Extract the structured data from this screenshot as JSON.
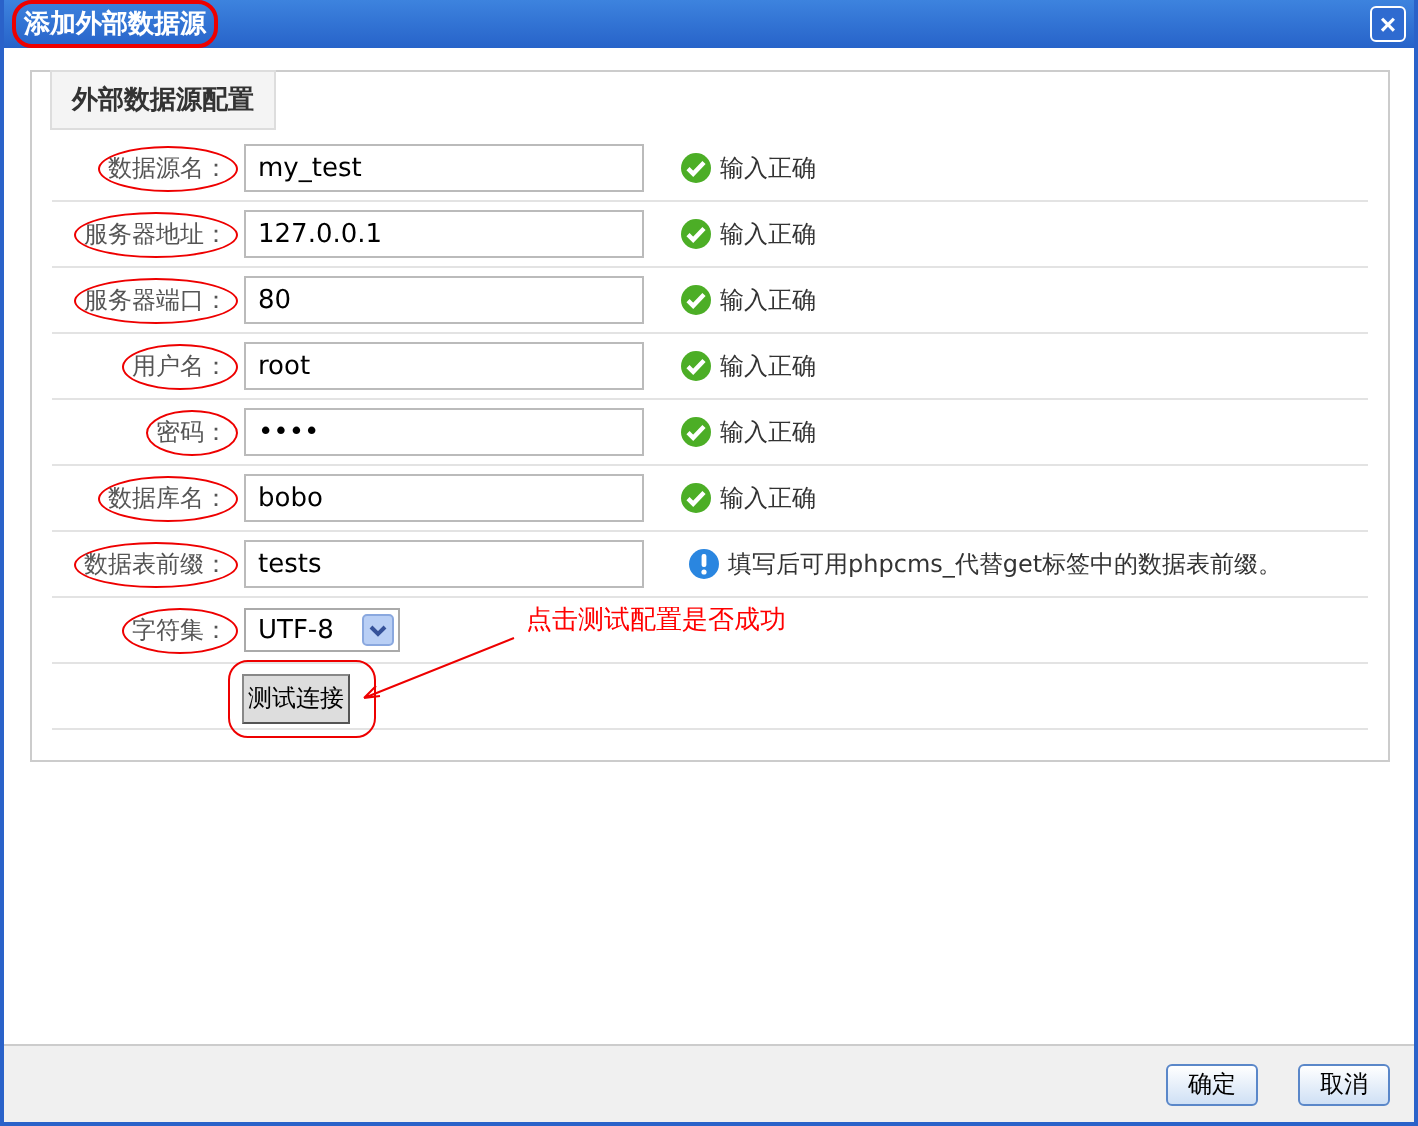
{
  "window": {
    "title": "添加外部数据源",
    "title_circled": true,
    "close": "×"
  },
  "fieldset": {
    "legend": "外部数据源配置"
  },
  "fields": [
    {
      "kind": "text",
      "label": "数据源名：",
      "circled": true,
      "value": "my_test",
      "status": {
        "kind": "ok",
        "text": "输入正确"
      }
    },
    {
      "kind": "text",
      "label": "服务器地址：",
      "circled": true,
      "value": "127.0.0.1",
      "status": {
        "kind": "ok",
        "text": "输入正确"
      }
    },
    {
      "kind": "text",
      "label": "服务器端口：",
      "circled": true,
      "value": "80",
      "status": {
        "kind": "ok",
        "text": "输入正确"
      }
    },
    {
      "kind": "text",
      "label": "用户名：",
      "circled": true,
      "value": "root",
      "status": {
        "kind": "ok",
        "text": "输入正确"
      }
    },
    {
      "kind": "text",
      "label": "密码：",
      "circled": true,
      "value": "••••",
      "status": {
        "kind": "ok",
        "text": "输入正确"
      }
    },
    {
      "kind": "text",
      "label": "数据库名：",
      "circled": true,
      "value": "bobo",
      "status": {
        "kind": "ok",
        "text": "输入正确"
      }
    },
    {
      "kind": "text",
      "label": "数据表前缀：",
      "circled": true,
      "value": "tests",
      "status": {
        "kind": "info",
        "text": "填写后可用phpcms_代替get标签中的数据表前缀。"
      }
    },
    {
      "kind": "select",
      "label": "字符集：",
      "circled": true,
      "value": "UTF-8"
    }
  ],
  "test_button": {
    "label": "测试连接",
    "circled": true
  },
  "annotation": {
    "text": "点击测试配置是否成功"
  },
  "buttons": [
    "确定",
    "取消"
  ]
}
